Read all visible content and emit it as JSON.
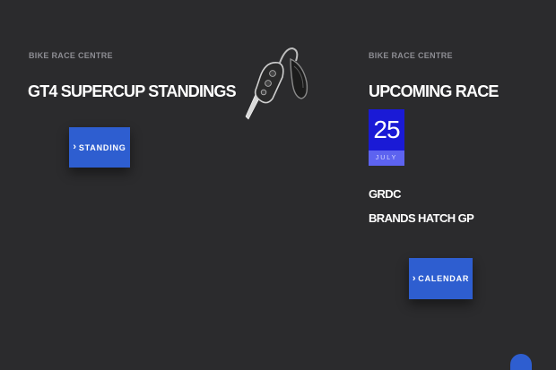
{
  "left_panel": {
    "eyebrow": "BIKE RACE CENTRE",
    "title": "GT4 SUPERCUP STANDINGS",
    "button_label": "STANDING"
  },
  "right_panel": {
    "eyebrow": "BIKE RACE CENTRE",
    "title": "UPCOMING RACE",
    "date": {
      "day": "25",
      "month": "JULY"
    },
    "race_name": "GRDC",
    "venue": "BRANDS HATCH GP",
    "button_label": "CALENDAR"
  },
  "decoration": {
    "image_icon": "car-key-fob-icon",
    "chevron_icon": "chevron-right-icon"
  },
  "colors": {
    "background": "#2b2b2d",
    "button": "#2e5ed0",
    "date_day_bg": "#1a1ad6",
    "date_month_bg": "#5d63f0",
    "eyebrow_text": "#8d8d93"
  }
}
